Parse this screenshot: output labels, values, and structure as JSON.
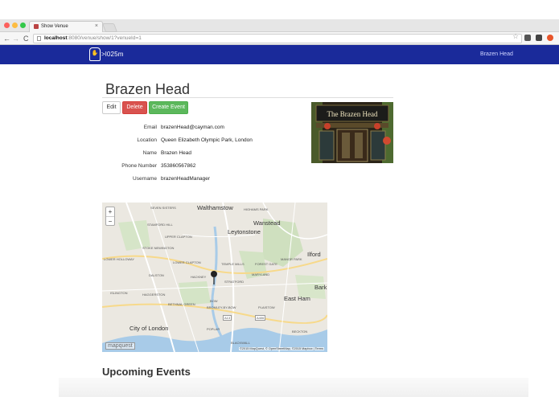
{
  "browser": {
    "tab_title": "Show Venue",
    "tab_close": "×",
    "url_host": "localhost",
    "url_rest": ":8080/venue/show/1?venueId=1",
    "back": "←",
    "forward": "→",
    "reload": "C",
    "star": "☆"
  },
  "navbar": {
    "brand": ">l025m",
    "right_link": "Brazen Head"
  },
  "venue": {
    "name": "Brazen Head",
    "buttons": {
      "edit": "Edit",
      "delete": "Delete",
      "create_event": "Create Event"
    },
    "details": [
      {
        "label": "Email",
        "value": "brazenHead@cayman.com"
      },
      {
        "label": "Location",
        "value": "Queen Elizabeth Olympic Park, London"
      },
      {
        "label": "Name",
        "value": "Brazen Head"
      },
      {
        "label": "Phone Number",
        "value": "353860567862"
      },
      {
        "label": "Username",
        "value": "brazenHeadManager"
      }
    ],
    "photo_sign": "The Brazen Head"
  },
  "map": {
    "zoom_in": "+",
    "zoom_out": "−",
    "labels": {
      "walthamstow": "Walthamstow",
      "wanstead": "Wanstead",
      "leytonstone": "Leytonstone",
      "ilford": "Ilford",
      "bark": "Bark",
      "east_ham": "East Ham",
      "city_of_london": "City of London",
      "seven_sisters": "SEVEN SISTERS",
      "stamford_hill": "STAMFORD HILL",
      "upper_clapton": "UPPER CLAPTON",
      "stoke_newington": "STOKE NEWINGTON",
      "lower_holloway": "LOWER HOLLOWAY",
      "dalston": "DALSTON",
      "hackney": "HACKNEY",
      "lower_clapton": "LOWER CLAPTON",
      "temple_mills": "TEMPLE MILLS",
      "forest_gate": "FOREST GATE",
      "manor_park": "MANOR PARK",
      "maryland": "MARYLAND",
      "stratford": "STRATFORD",
      "islington": "ISLINGTON",
      "haggerston": "HAGGERSTON",
      "bethnal_green": "BETHNAL GREEN",
      "bow": "BOW",
      "bromley_by_bow": "BROMLEY-BY-BOW",
      "plaistow": "PLAISTOW",
      "poplar": "POPLAR",
      "beckton": "BECKTON",
      "blackwall": "BLACKWALL",
      "highams_park": "HIGHAMS PARK",
      "road_a406": "A406",
      "road_a13": "A13"
    },
    "logo": "mapquest",
    "attribution": "©2015 MapQuest, © OpenStreetMap, ©2015 Mapbox | Terms"
  },
  "events": {
    "heading": "Upcoming Events"
  },
  "colors": {
    "navbar": "#1a2a9a",
    "delete": "#d9534f",
    "create": "#5cb85c"
  }
}
